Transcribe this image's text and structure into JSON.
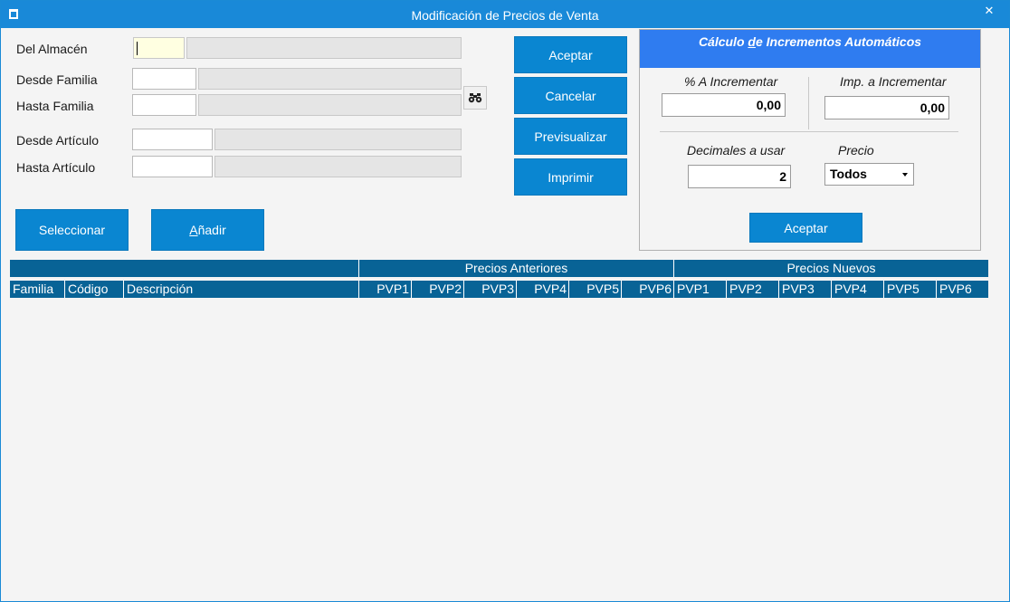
{
  "window": {
    "title": "Modificación de Precios de Venta",
    "close_glyph": "✕"
  },
  "filters": {
    "almacen_label": "Del Almacén",
    "desde_familia_label": "Desde Familia",
    "hasta_familia_label": "Hasta Familia",
    "desde_articulo_label": "Desde Artículo",
    "hasta_articulo_label": "Hasta Artículo"
  },
  "actions": {
    "aceptar": "Aceptar",
    "cancelar": "Cancelar",
    "previsualizar": "Previsualizar",
    "imprimir": "Imprimir",
    "seleccionar": "Seleccionar",
    "anadir_first": "A",
    "anadir_rest": "ñadir"
  },
  "auto_panel": {
    "title_pre": "Cálculo ",
    "title_underline": "d",
    "title_post": "e Incrementos Automáticos",
    "pct_label": "% A Incrementar",
    "pct_value": "0,00",
    "imp_label": "Imp. a Incrementar",
    "imp_value": "0,00",
    "decimales_label": "Decimales a usar",
    "decimales_value": "2",
    "precio_label": "Precio",
    "precio_selected": "Todos",
    "aceptar": "Aceptar"
  },
  "grid": {
    "group_anteriores": "Precios Anteriores",
    "group_nuevos": "Precios Nuevos",
    "columns": [
      "Familia",
      "Código",
      "Descripción",
      "PVP1",
      "PVP2",
      "PVP3",
      "PVP4",
      "PVP5",
      "PVP6",
      "PVP1",
      "PVP2",
      "PVP3",
      "PVP4",
      "PVP5",
      "PVP6"
    ]
  },
  "colors": {
    "titlebar": "#1989d8",
    "button": "#0a86d1",
    "panel_header": "#2f7cf0",
    "grid_header": "#086396"
  },
  "icons": {
    "app": "app-icon",
    "find": "binoculars-icon",
    "close": "close-icon",
    "dropdown": "chevron-down-icon"
  }
}
